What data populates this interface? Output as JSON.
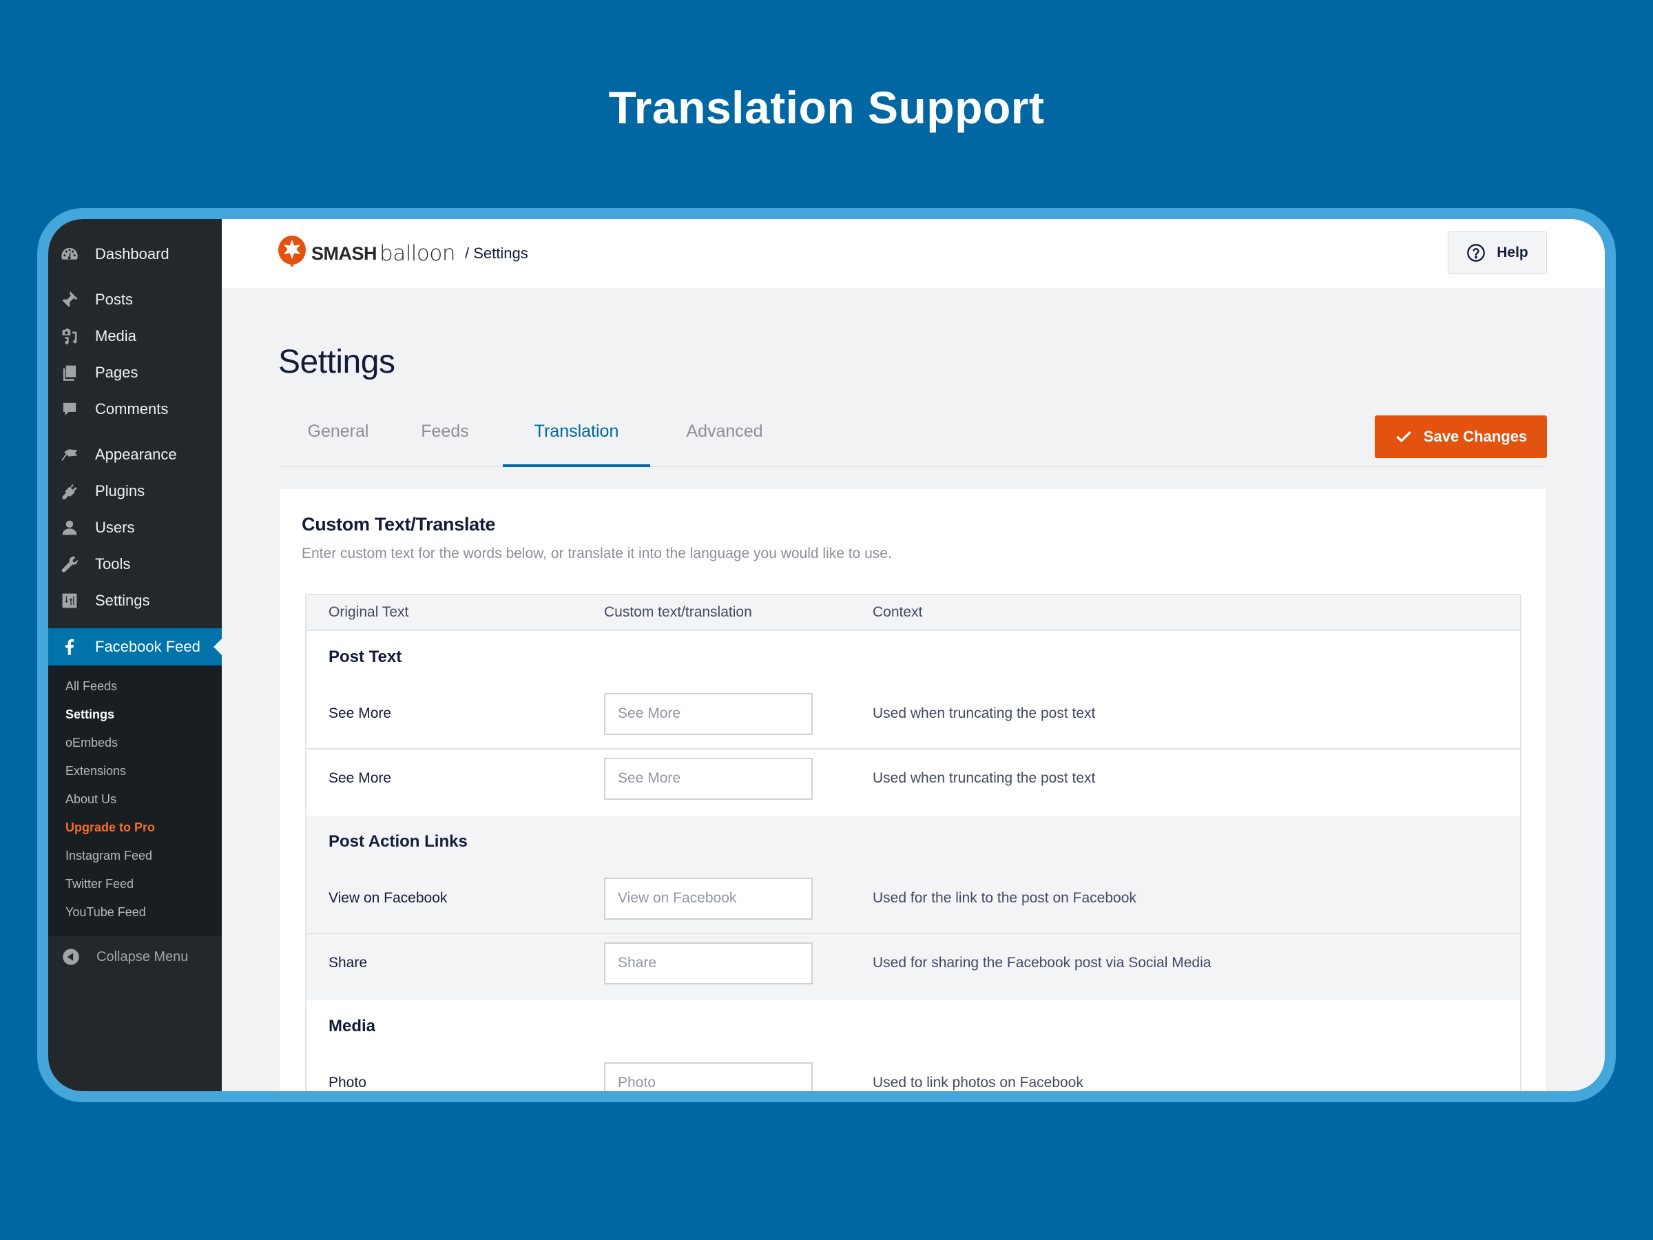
{
  "hero": {
    "title": "Translation Support"
  },
  "colors": {
    "background": "#0067a2",
    "frame": "#44a6da",
    "sidebar": "#23282d",
    "sidebar_active": "#0073aa",
    "accent_tab": "#0068a0",
    "save_button": "#e3520f",
    "upgrade_link": "#f56e28"
  },
  "sidebar": {
    "items": [
      {
        "label": "Dashboard",
        "icon": "dashboard-icon"
      },
      {
        "label": "Posts",
        "icon": "pushpin-icon"
      },
      {
        "label": "Media",
        "icon": "media-icon"
      },
      {
        "label": "Pages",
        "icon": "pages-icon"
      },
      {
        "label": "Comments",
        "icon": "comment-icon"
      },
      {
        "label": "Appearance",
        "icon": "paintbrush-icon"
      },
      {
        "label": "Plugins",
        "icon": "plugin-icon"
      },
      {
        "label": "Users",
        "icon": "user-icon"
      },
      {
        "label": "Tools",
        "icon": "wrench-icon"
      },
      {
        "label": "Settings",
        "icon": "settings-sliders-icon"
      }
    ],
    "active": {
      "label": "Facebook Feed",
      "icon": "facebook-icon"
    },
    "submenu": [
      {
        "label": "All Feeds"
      },
      {
        "label": "Settings"
      },
      {
        "label": "oEmbeds"
      },
      {
        "label": "Extensions"
      },
      {
        "label": "About Us"
      },
      {
        "label": "Upgrade to Pro"
      },
      {
        "label": "Instagram Feed"
      },
      {
        "label": "Twitter Feed"
      },
      {
        "label": "YouTube Feed"
      }
    ],
    "collapse_label": "Collapse Menu"
  },
  "header": {
    "logo_bold": "SMASH",
    "logo_light": "balloon",
    "breadcrumb": "/ Settings",
    "help_label": "Help"
  },
  "page": {
    "title": "Settings",
    "tabs": [
      {
        "label": "General"
      },
      {
        "label": "Feeds"
      },
      {
        "label": "Translation",
        "active": true
      },
      {
        "label": "Advanced"
      }
    ],
    "save_label": "Save Changes"
  },
  "card": {
    "title": "Custom Text/Translate",
    "description": "Enter custom text for the words below, or translate it into the language you would like to use.",
    "table": {
      "headers": [
        "Original Text",
        "Custom text/translation",
        "Context"
      ],
      "groups": [
        {
          "title": "Post Text",
          "rows": [
            {
              "original": "See More",
              "placeholder": "See More",
              "value": "",
              "context": "Used when truncating the post text"
            },
            {
              "original": "See More",
              "placeholder": "See More",
              "value": "",
              "context": "Used when truncating the post text"
            }
          ]
        },
        {
          "title": "Post Action Links",
          "rows": [
            {
              "original": "View on Facebook",
              "placeholder": "View on Facebook",
              "value": "",
              "context": "Used for the link to the post on Facebook"
            },
            {
              "original": "Share",
              "placeholder": "Share",
              "value": "",
              "context": "Used for sharing the Facebook post via Social Media"
            }
          ]
        },
        {
          "title": "Media",
          "rows": [
            {
              "original": "Photo",
              "placeholder": "Photo",
              "value": "",
              "context": "Used to link photos on Facebook"
            }
          ]
        }
      ]
    }
  }
}
